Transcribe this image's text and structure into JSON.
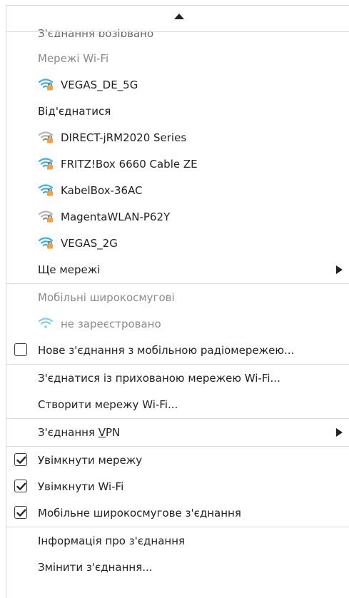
{
  "cut_item": "З'єднання розірвано",
  "wifi_section": {
    "heading": "Мережі Wi-Fi",
    "connected": {
      "name": "VEGAS_DE_5G",
      "icon": "wifi-secured-icon",
      "color": "#3daee9"
    },
    "disconnect_label": "Від'єднатися",
    "networks": [
      {
        "name": "DIRECT-jRM2020 Series",
        "icon": "wifi-secured-weak-icon",
        "color": "#9a9a9a"
      },
      {
        "name": "FRITZ!Box 6660 Cable ZE",
        "icon": "wifi-secured-icon",
        "color": "#3daee9"
      },
      {
        "name": "KabelBox-36AC",
        "icon": "wifi-secured-icon",
        "color": "#3daee9"
      },
      {
        "name": "MagentaWLAN-P62Y",
        "icon": "wifi-secured-weak-icon",
        "color": "#9a9a9a"
      },
      {
        "name": "VEGAS_2G",
        "icon": "wifi-secured-icon",
        "color": "#3daee9"
      }
    ],
    "more_label": "Ще мережі"
  },
  "mobile_section": {
    "heading": "Мобільні широкосмугові",
    "status": "не зареєстровано",
    "new_connection_label": "Нове з'єднання з мобільною радіомережею...",
    "new_connection_checked": false
  },
  "actions": {
    "connect_hidden": "З'єднатися із прихованою мережею Wi-Fi...",
    "create_wifi": "Створити мережу Wi-Fi..."
  },
  "vpn": {
    "label_prefix": "З'єднання ",
    "label_underlined": "V",
    "label_suffix": "PN"
  },
  "toggles": [
    {
      "label": "Увімкнути мережу",
      "checked": true
    },
    {
      "label": "Увімкнути Wi-Fi",
      "checked": true
    },
    {
      "label": "Мобільне широкосмугове з'єднання",
      "checked": true
    }
  ],
  "footer": {
    "info_label": "Інформація про з'єднання",
    "edit_label": "Змінити з'єднання..."
  },
  "colors": {
    "accent": "#3daee9",
    "text": "#222222",
    "muted": "#8a8a8a",
    "separator": "#dadada"
  }
}
